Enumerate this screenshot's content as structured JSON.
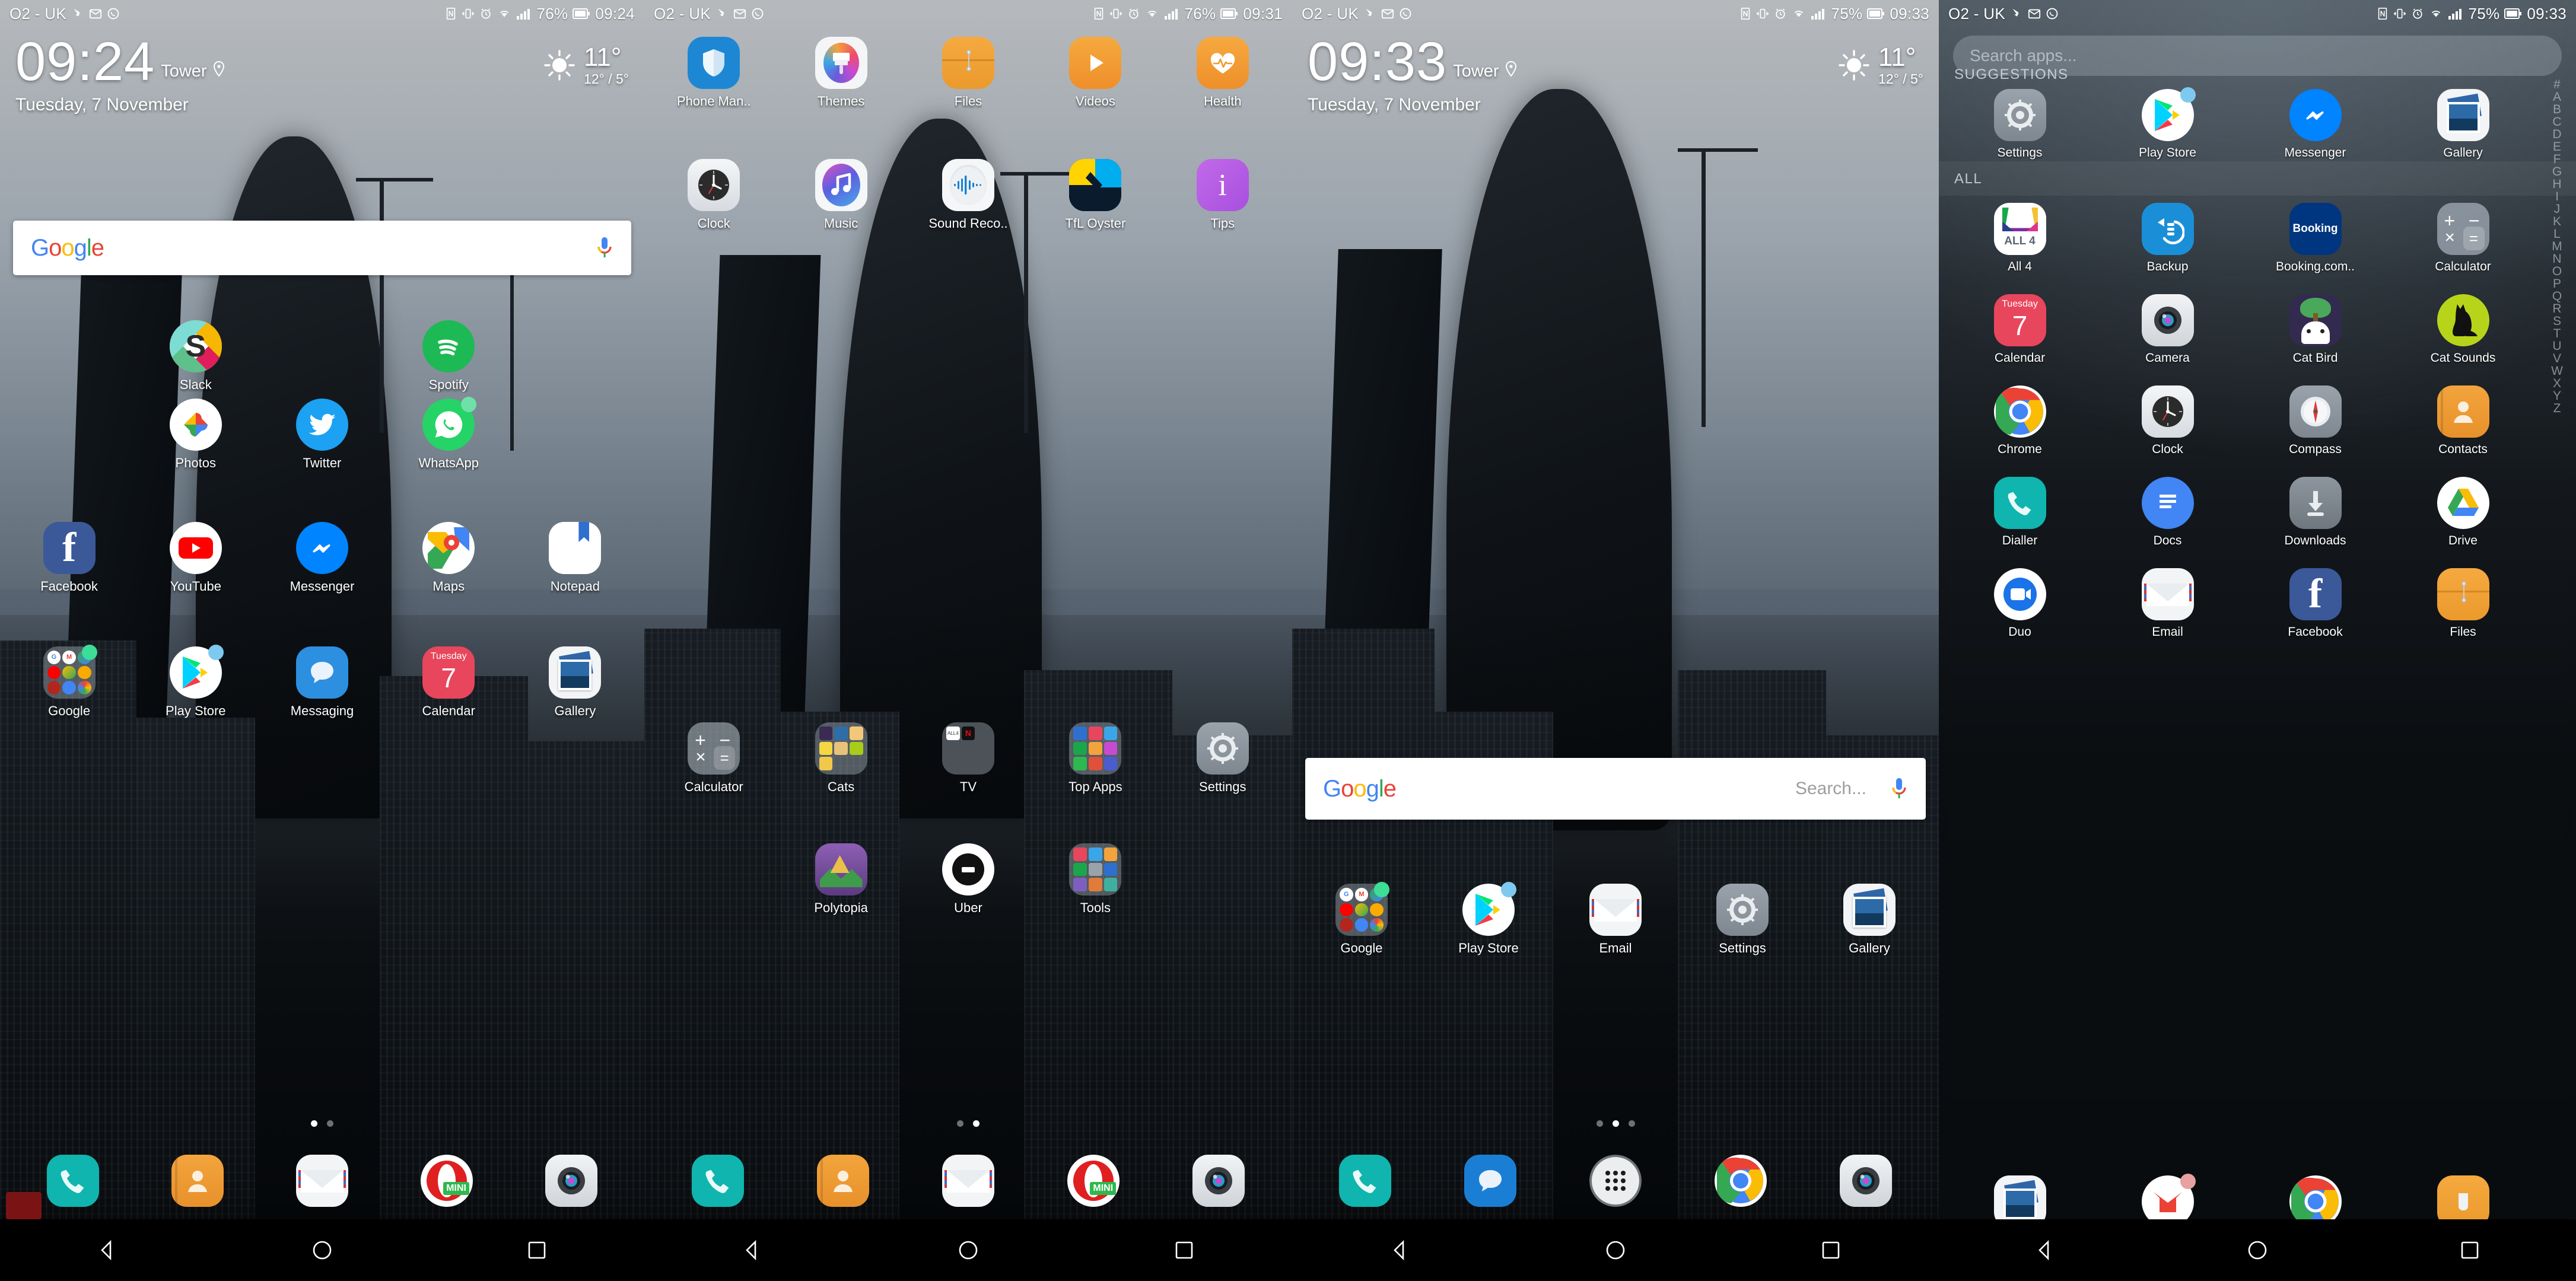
{
  "statusbar": {
    "carrier": "O2 - UK",
    "left_icons": [
      "play-store-update-icon",
      "gmail-icon",
      "whatsapp-icon"
    ],
    "right_icons": [
      "nfc-icon",
      "vibrate-icon",
      "alarm-icon",
      "wifi-icon",
      "signal-icon"
    ],
    "battery_p1": "76%",
    "battery_p2": "76%",
    "battery_p3": "75%",
    "battery_p4": "75%",
    "time_p1": "09:24",
    "time_p2": "09:31",
    "time_p3": "09:33",
    "time_p4": "09:33"
  },
  "clock_widget": {
    "time_p1": "09:24",
    "time_p3": "09:33",
    "location": "Tower",
    "date": "Tuesday, 7 November",
    "temp_now": "11°",
    "temp_high_low": "12° / 5°",
    "weather_icon": "sun-icon"
  },
  "google_widget": {
    "logo": [
      "G",
      "o",
      "o",
      "g",
      "l",
      "e"
    ],
    "placeholder": "Search...",
    "mic_icon": "microphone-icon"
  },
  "drawer": {
    "search_placeholder": "Search apps...",
    "section_suggestions": "SUGGESTIONS",
    "section_all": "ALL",
    "alphabet": [
      "#",
      "A",
      "B",
      "C",
      "D",
      "E",
      "F",
      "G",
      "H",
      "I",
      "J",
      "K",
      "L",
      "M",
      "N",
      "O",
      "P",
      "Q",
      "R",
      "S",
      "T",
      "U",
      "V",
      "W",
      "X",
      "Y",
      "Z"
    ],
    "suggestions": [
      {
        "label": "Settings",
        "icon": "settings-gear-icon"
      },
      {
        "label": "Play Store",
        "icon": "play-store-icon",
        "badge": "#7ec9f0"
      },
      {
        "label": "Messenger",
        "icon": "messenger-icon"
      },
      {
        "label": "Gallery",
        "icon": "gallery-icon"
      }
    ],
    "all_apps": [
      {
        "label": "All 4",
        "icon": "all4-icon"
      },
      {
        "label": "Backup",
        "icon": "backup-icon"
      },
      {
        "label": "Booking.com..",
        "icon": "booking-icon"
      },
      {
        "label": "Calculator",
        "icon": "calculator-icon"
      },
      {
        "label": "Calendar",
        "icon": "calendar-icon",
        "day": "Tuesday",
        "date": "7"
      },
      {
        "label": "Camera",
        "icon": "camera-icon"
      },
      {
        "label": "Cat Bird",
        "icon": "cat-bird-icon"
      },
      {
        "label": "Cat Sounds",
        "icon": "cat-sounds-icon"
      },
      {
        "label": "Chrome",
        "icon": "chrome-icon"
      },
      {
        "label": "Clock",
        "icon": "clock-icon"
      },
      {
        "label": "Compass",
        "icon": "compass-icon"
      },
      {
        "label": "Contacts",
        "icon": "contacts-icon"
      },
      {
        "label": "Dialler",
        "icon": "phone-icon"
      },
      {
        "label": "Docs",
        "icon": "google-docs-icon"
      },
      {
        "label": "Downloads",
        "icon": "downloads-icon"
      },
      {
        "label": "Drive",
        "icon": "google-drive-icon"
      },
      {
        "label": "Duo",
        "icon": "duo-icon"
      },
      {
        "label": "Email",
        "icon": "email-icon"
      },
      {
        "label": "Facebook",
        "icon": "facebook-icon"
      },
      {
        "label": "Files",
        "icon": "files-icon"
      }
    ]
  },
  "panel1": {
    "rows": [
      [
        {
          "label": "Slack",
          "icon": "slack-icon"
        },
        {
          "label": "Spotify",
          "icon": "spotify-icon"
        }
      ],
      [
        {
          "label": "Photos",
          "icon": "google-photos-icon"
        },
        {
          "label": "Twitter",
          "icon": "twitter-icon"
        },
        {
          "label": "WhatsApp",
          "icon": "whatsapp-icon",
          "badge": "#6fe0a8"
        }
      ],
      [
        {
          "label": "Facebook",
          "icon": "facebook-icon"
        },
        {
          "label": "YouTube",
          "icon": "youtube-icon"
        },
        {
          "label": "Messenger",
          "icon": "messenger-icon"
        },
        {
          "label": "Maps",
          "icon": "google-maps-icon"
        },
        {
          "label": "Notepad",
          "icon": "notepad-icon"
        }
      ],
      [
        {
          "label": "Google",
          "icon": "google-folder-icon",
          "badge": "#3ddc97"
        },
        {
          "label": "Play Store",
          "icon": "play-store-icon",
          "badge": "#7ec9f0"
        },
        {
          "label": "Messaging",
          "icon": "messaging-icon"
        },
        {
          "label": "Calendar",
          "icon": "calendar-icon",
          "day": "Tuesday",
          "date": "7"
        },
        {
          "label": "Gallery",
          "icon": "gallery-icon"
        }
      ]
    ],
    "page_dots": 2,
    "active_dot": 0,
    "dock": [
      {
        "label": "Dialler",
        "icon": "phone-icon"
      },
      {
        "label": "Contacts",
        "icon": "contacts-icon"
      },
      {
        "label": "Email",
        "icon": "email-icon"
      },
      {
        "label": "Opera Mini",
        "icon": "opera-mini-icon"
      },
      {
        "label": "Camera",
        "icon": "camera-icon"
      }
    ]
  },
  "panel2": {
    "rows": [
      [
        {
          "label": "Phone Man..",
          "icon": "phone-manager-icon"
        },
        {
          "label": "Themes",
          "icon": "themes-icon"
        },
        {
          "label": "Files",
          "icon": "files-icon"
        },
        {
          "label": "Videos",
          "icon": "videos-icon"
        },
        {
          "label": "Health",
          "icon": "health-icon"
        }
      ],
      [
        {
          "label": "Clock",
          "icon": "clock-icon"
        },
        {
          "label": "Music",
          "icon": "music-icon"
        },
        {
          "label": "Sound Reco..",
          "icon": "sound-recorder-icon"
        },
        {
          "label": "TfL Oyster",
          "icon": "tfl-oyster-icon"
        },
        {
          "label": "Tips",
          "icon": "tips-icon"
        }
      ],
      [
        {
          "label": "Calculator",
          "icon": "calculator-icon"
        },
        {
          "label": "Cats",
          "icon": "cats-folder-icon"
        },
        {
          "label": "TV",
          "icon": "tv-folder-icon"
        },
        {
          "label": "Top Apps",
          "icon": "top-apps-folder-icon"
        },
        {
          "label": "Settings",
          "icon": "settings-gear-icon"
        }
      ],
      [
        {
          "label": "Polytopia",
          "icon": "polytopia-icon"
        },
        {
          "label": "Uber",
          "icon": "uber-icon"
        },
        {
          "label": "Tools",
          "icon": "tools-folder-icon"
        }
      ]
    ],
    "page_dots": 2,
    "active_dot": 1,
    "dock": [
      {
        "label": "Dialler",
        "icon": "phone-icon"
      },
      {
        "label": "Contacts",
        "icon": "contacts-icon"
      },
      {
        "label": "Email",
        "icon": "email-icon"
      },
      {
        "label": "Opera Mini",
        "icon": "opera-mini-icon"
      },
      {
        "label": "Camera",
        "icon": "camera-icon"
      }
    ]
  },
  "panel3": {
    "rows": [
      [
        {
          "label": "Google",
          "icon": "google-folder-icon",
          "badge": "#3ddc97"
        },
        {
          "label": "Play Store",
          "icon": "play-store-icon",
          "badge": "#7ec9f0"
        },
        {
          "label": "Email",
          "icon": "email-icon"
        },
        {
          "label": "Settings",
          "icon": "settings-gear-icon"
        },
        {
          "label": "Gallery",
          "icon": "gallery-icon"
        }
      ]
    ],
    "page_dots": 3,
    "active_dot": 1,
    "dock": [
      {
        "label": "Dialler",
        "icon": "phone-icon"
      },
      {
        "label": "Messages",
        "icon": "messages-icon"
      },
      {
        "label": "App Drawer",
        "icon": "app-drawer-icon"
      },
      {
        "label": "Chrome",
        "icon": "chrome-icon"
      },
      {
        "label": "Camera",
        "icon": "camera-icon"
      }
    ]
  },
  "navbar": {
    "back": "back-icon",
    "home": "home-icon",
    "recents": "recents-icon"
  }
}
